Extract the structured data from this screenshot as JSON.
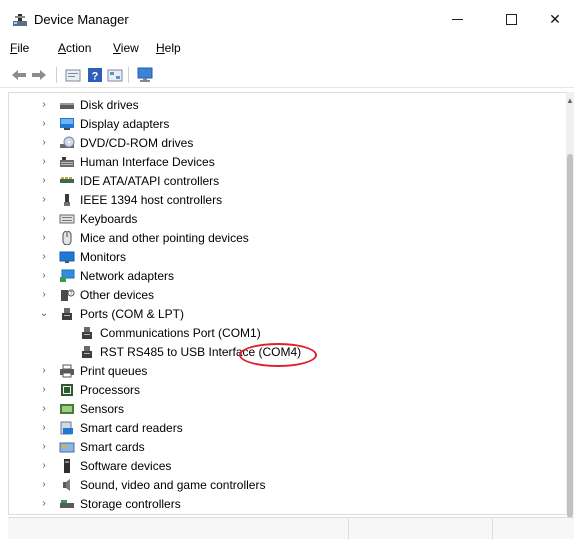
{
  "window": {
    "title": "Device Manager",
    "controls": {
      "minimize": "minimize",
      "maximize": "maximize",
      "close": "✕"
    }
  },
  "menu": [
    {
      "label": "File",
      "accel": "F",
      "rest": "ile"
    },
    {
      "label": "Action",
      "accel": "A",
      "rest": "ction"
    },
    {
      "label": "View",
      "accel": "V",
      "rest": "iew"
    },
    {
      "label": "Help",
      "accel": "H",
      "rest": "elp"
    }
  ],
  "toolbar": {
    "buttons": [
      "back-arrow-icon",
      "forward-arrow-icon",
      "properties-icon",
      "help-icon",
      "update-driver-icon",
      "scan-hardware-icon"
    ]
  },
  "tree": {
    "items": [
      {
        "label": "Disk drives",
        "icon": "disk-drive-icon",
        "expanded": false,
        "level": 0
      },
      {
        "label": "Display adapters",
        "icon": "display-adapter-icon",
        "expanded": false,
        "level": 0
      },
      {
        "label": "DVD/CD-ROM drives",
        "icon": "dvd-drive-icon",
        "expanded": false,
        "level": 0
      },
      {
        "label": "Human Interface Devices",
        "icon": "hid-icon",
        "expanded": false,
        "level": 0
      },
      {
        "label": "IDE ATA/ATAPI controllers",
        "icon": "ide-controller-icon",
        "expanded": false,
        "level": 0
      },
      {
        "label": "IEEE 1394 host controllers",
        "icon": "ieee1394-icon",
        "expanded": false,
        "level": 0
      },
      {
        "label": "Keyboards",
        "icon": "keyboard-icon",
        "expanded": false,
        "level": 0
      },
      {
        "label": "Mice and other pointing devices",
        "icon": "mouse-icon",
        "expanded": false,
        "level": 0
      },
      {
        "label": "Monitors",
        "icon": "monitor-icon",
        "expanded": false,
        "level": 0
      },
      {
        "label": "Network adapters",
        "icon": "network-adapter-icon",
        "expanded": false,
        "level": 0
      },
      {
        "label": "Other devices",
        "icon": "other-devices-icon",
        "expanded": false,
        "level": 0
      },
      {
        "label": "Ports (COM & LPT)",
        "icon": "port-icon",
        "expanded": true,
        "level": 0
      },
      {
        "label": "Communications Port (COM1)",
        "icon": "port-icon",
        "level": 1
      },
      {
        "label": "RST RS485 to USB Interface (COM4)",
        "icon": "port-icon",
        "level": 1,
        "highlighted": true
      },
      {
        "label": "Print queues",
        "icon": "printer-icon",
        "expanded": false,
        "level": 0
      },
      {
        "label": "Processors",
        "icon": "processor-icon",
        "expanded": false,
        "level": 0
      },
      {
        "label": "Sensors",
        "icon": "sensor-icon",
        "expanded": false,
        "level": 0
      },
      {
        "label": "Smart card readers",
        "icon": "smart-card-reader-icon",
        "expanded": false,
        "level": 0
      },
      {
        "label": "Smart cards",
        "icon": "smart-card-icon",
        "expanded": false,
        "level": 0
      },
      {
        "label": "Software devices",
        "icon": "software-device-icon",
        "expanded": false,
        "level": 0
      },
      {
        "label": "Sound, video and game controllers",
        "icon": "sound-icon",
        "expanded": false,
        "level": 0
      },
      {
        "label": "Storage controllers",
        "icon": "storage-controller-icon",
        "expanded": false,
        "level": 0
      }
    ]
  },
  "colors": {
    "highlight_ellipse": "#e0202a",
    "monitor_blue": "#1e78d4"
  }
}
